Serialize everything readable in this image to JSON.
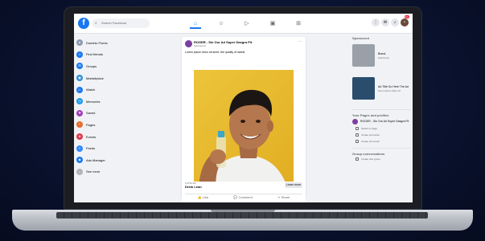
{
  "nav": {
    "logo": "f",
    "search_placeholder": "Search Facebook",
    "icons": [
      "home-icon",
      "friends-icon",
      "watch-icon",
      "marketplace-icon",
      "groups-icon"
    ],
    "right_icons": [
      "menu-icon",
      "messenger-icon",
      "notifications-icon",
      "account-icon"
    ],
    "notification_badge": "20+"
  },
  "sidebar": {
    "items": [
      {
        "label": "Dominic Flores",
        "icon": "profile-icon",
        "color": "#8e9aaf"
      },
      {
        "label": "Find friends",
        "icon": "friends-icon",
        "color": "#1877f2"
      },
      {
        "label": "Groups",
        "icon": "groups-icon",
        "color": "#1877f2"
      },
      {
        "label": "Marketplace",
        "icon": "marketplace-icon",
        "color": "#2c8fd6"
      },
      {
        "label": "Watch",
        "icon": "watch-icon",
        "color": "#1877f2"
      },
      {
        "label": "Memories",
        "icon": "memories-icon",
        "color": "#1e9be8"
      },
      {
        "label": "Saved",
        "icon": "saved-icon",
        "color": "#a33dbb"
      },
      {
        "label": "Pages",
        "icon": "pages-icon",
        "color": "#e56b2b"
      },
      {
        "label": "Events",
        "icon": "events-icon",
        "color": "#e0394b"
      },
      {
        "label": "Feeds",
        "icon": "feeds-icon",
        "color": "#2d88ff"
      },
      {
        "label": "Ads Manager",
        "icon": "ads-icon",
        "color": "#1877f2"
      },
      {
        "label": "See more",
        "icon": "chevron-down-icon",
        "color": "#b0b3b8"
      }
    ]
  },
  "post": {
    "author": "ROGER - Sin Our Ad Super Dasgra Fit",
    "time": "Sponsored · ",
    "caption": "Lorem ipsum dolor sit amet, the quality of sweat.",
    "domain": "LUTIS.SO",
    "headline": "Drink Lean",
    "cta_label": "Learn more",
    "actions": [
      "Like",
      "Comment",
      "Share"
    ]
  },
  "right": {
    "sponsored_label": "Sponsored",
    "ads": [
      {
        "title": "Brand",
        "subtitle": "brand.com",
        "thumb_color": "#9aa0a8"
      },
      {
        "title": "Ad Title Go Here The Ad",
        "subtitle": "lorem ipsum dolor sit",
        "thumb_color": "#2a4d6e"
      }
    ],
    "pages_heading": "Your Pages and profiles",
    "page_name": "ROGER - Sin Our Ad Super Dasgra Fit",
    "page_sub": [
      "Switch to Page",
      "Create promotion",
      "Create promotion"
    ],
    "group_heading": "Group conversations",
    "group_action": "Create new group"
  },
  "colors": {
    "accent": "#1877f2",
    "photo_bg": "#e8b82a",
    "bezel": "#1b1d22",
    "backdrop": "#0a1330"
  }
}
